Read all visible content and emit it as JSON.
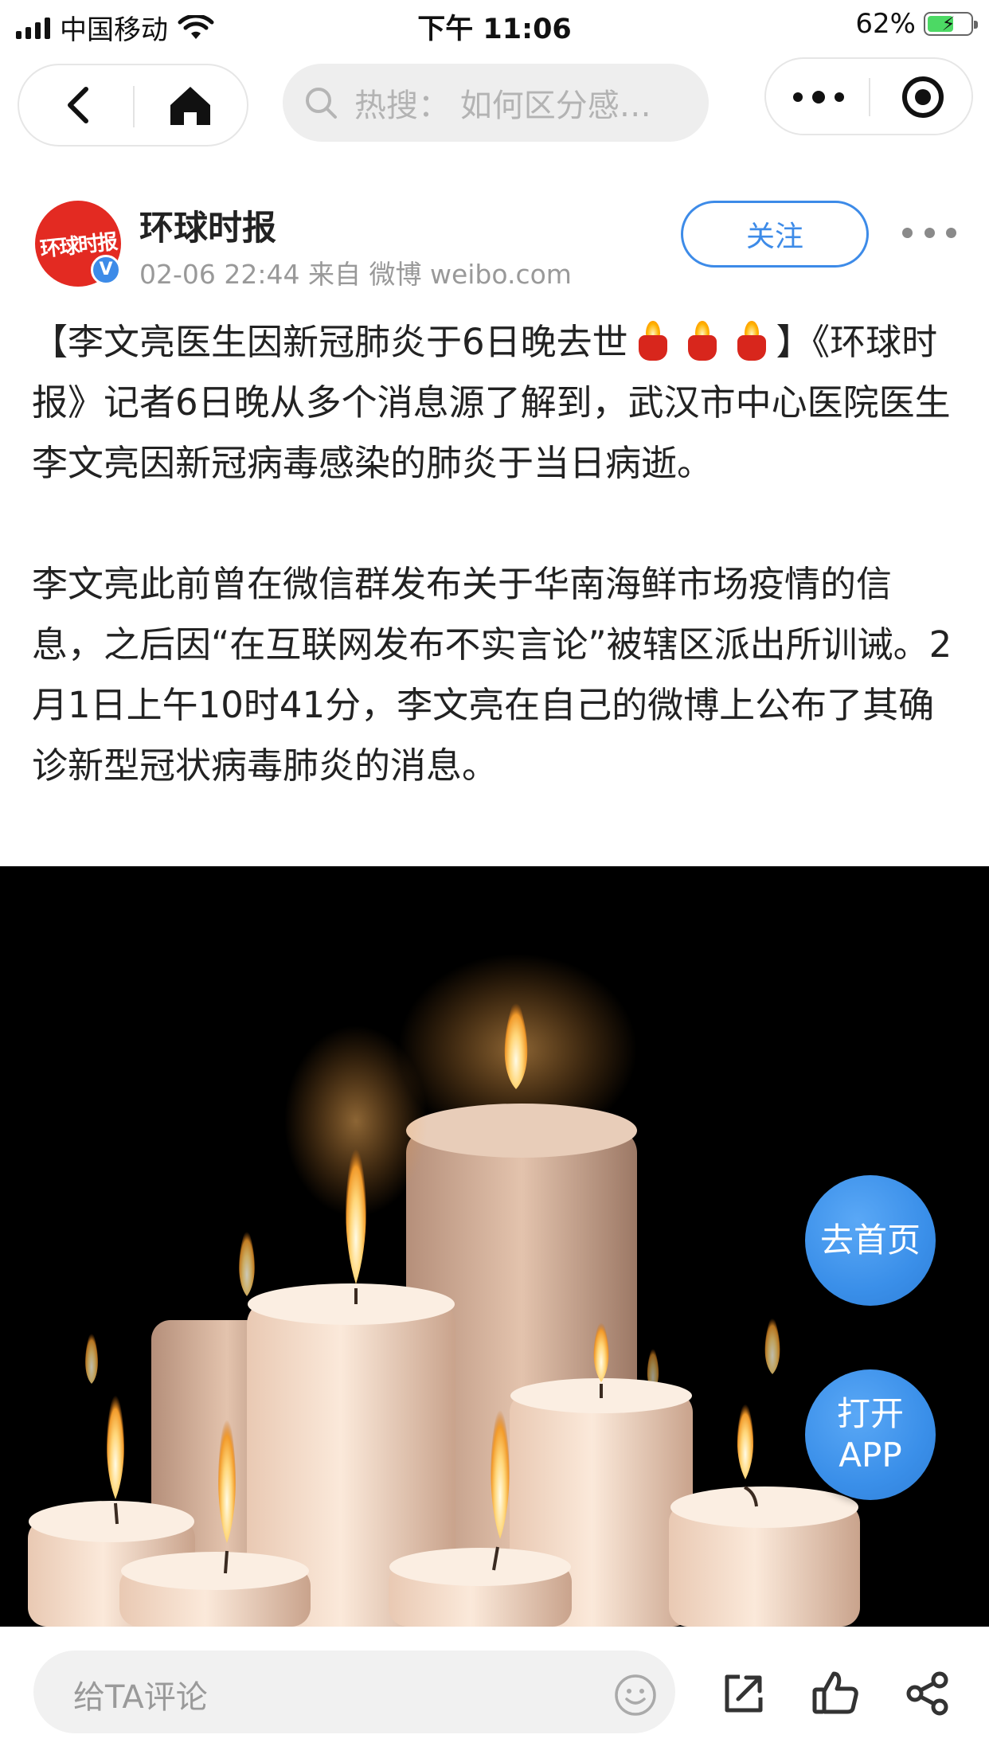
{
  "status_bar": {
    "carrier": "中国移动",
    "time": "下午 11:06",
    "battery_percent_label": "62%",
    "battery_level": 0.62
  },
  "nav": {
    "search_placeholder": "热搜：  如何区分感…"
  },
  "post": {
    "author": "环球时报",
    "avatar_logo_text": "环球时报",
    "verified_mark": "V",
    "meta": "02-06 22:44  来自 微博 weibo.com",
    "follow_label": "关注",
    "title_open": "【李文亮医生因新冠肺炎于6日晚去世",
    "title_close": "】《环球时报》记者6日晚从多个消息源了解到，武汉市中心医院医生李文亮因新冠病毒感染的肺炎于当日病逝。",
    "paragraph2": "李文亮此前曾在微信群发布关于华南海鲜市场疫情的信息，之后因“在互联网发布不实言论”被辖区派出所训诫。2月1日上午10时41分，李文亮在自己的微博上公布了其确诊新型冠状病毒肺炎的消息。",
    "candle_emoji_count": 3
  },
  "fabs": {
    "home_label": "去首页",
    "app_line1": "打开",
    "app_line2": "APP"
  },
  "bottom_bar": {
    "comment_placeholder": "给TA评论"
  },
  "colors": {
    "accent_blue": "#3d8be8",
    "avatar_red": "#e32a22",
    "text_primary": "#222222",
    "text_secondary": "#999999"
  },
  "icons": [
    "signal-icon",
    "wifi-icon",
    "battery-icon",
    "back-icon",
    "home-icon",
    "search-icon",
    "more-icon",
    "close-target-icon",
    "verified-icon",
    "candle-emoji-icon",
    "emoji-icon",
    "share-icon",
    "like-icon",
    "forward-icon"
  ]
}
